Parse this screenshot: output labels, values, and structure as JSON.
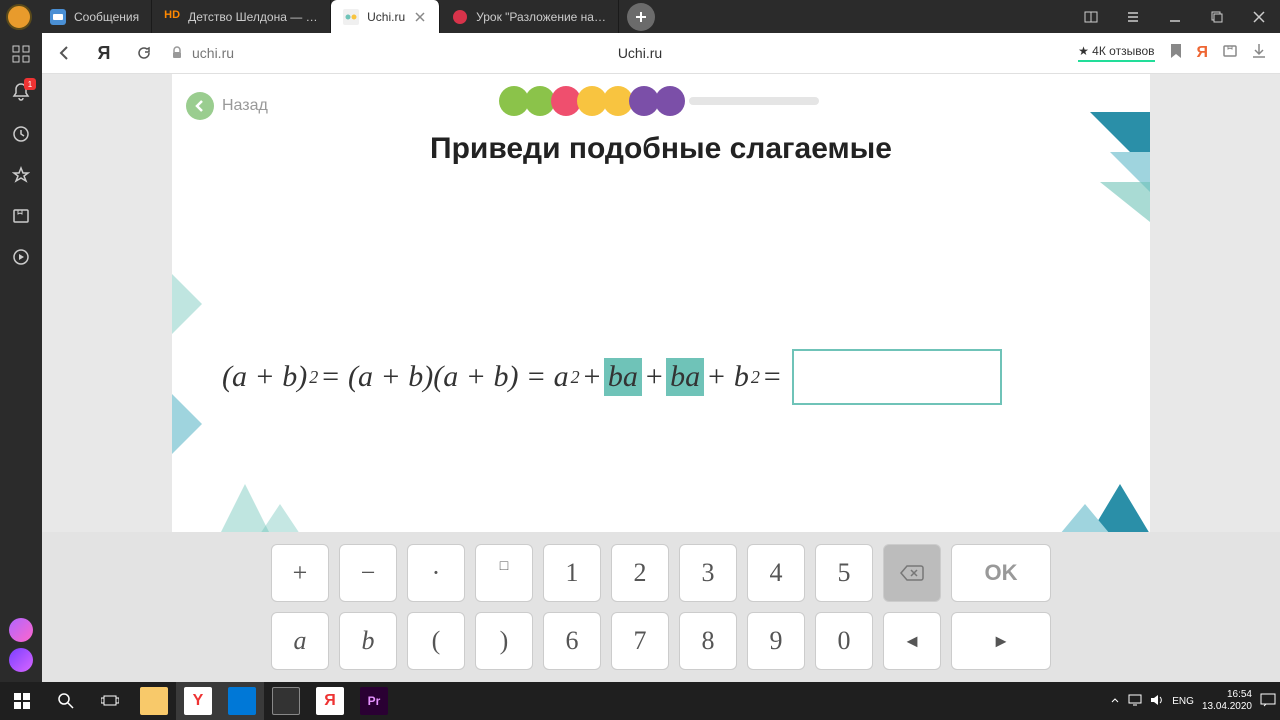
{
  "tabs": [
    {
      "label": "Сообщения",
      "icon_color": "#4a8fd4"
    },
    {
      "label": "Детство Шелдона — смот",
      "icon_color": "#ff8800"
    },
    {
      "label": "Uchi.ru",
      "icon_color": "#6fc3b8",
      "active": true
    },
    {
      "label": "Урок \"Разложение на мн",
      "icon_color": "#d8334a"
    }
  ],
  "url": "uchi.ru",
  "page_heading": "Uchi.ru",
  "rating": "4К отзывов",
  "sidebar_badge": "1",
  "lesson": {
    "back_label": "Назад",
    "title": "Приведи подобные слагаемые",
    "progress_colors": [
      "#8bc34a",
      "#8bc34a",
      "#ef4f6e",
      "#f8c440",
      "#f8c440",
      "#7b4fa8",
      "#7b4fa8"
    ],
    "equation": {
      "p1": "(a + b)",
      "e1": "2",
      "p2": " = (a + b)(a + b) = a",
      "e2": "2",
      "p3": " + ",
      "hl1": "ba",
      "p4": " + ",
      "hl2": "ba",
      "p5": " + b",
      "e3": "2",
      "p6": " = "
    },
    "answer": ""
  },
  "keyboard": {
    "r1": [
      "+",
      "−",
      "·",
      "□"
    ],
    "r2": [
      "a",
      "b",
      "(",
      ")"
    ],
    "n1": [
      "1",
      "2",
      "3",
      "4",
      "5"
    ],
    "n2": [
      "6",
      "7",
      "8",
      "9",
      "0"
    ],
    "backspace": "⌫",
    "ok": "OK",
    "left": "◄",
    "right": "►"
  },
  "taskbar": {
    "lang": "ENG",
    "time": "16:54",
    "date": "13.04.2020"
  }
}
